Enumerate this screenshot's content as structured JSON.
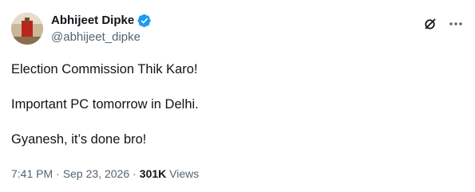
{
  "author": {
    "display_name": "Abhijeet Dipke",
    "handle": "@abhijeet_dipke",
    "verified": true,
    "verified_color": "#1d9bf0"
  },
  "header_actions": [
    {
      "icon": "grok-icon"
    },
    {
      "icon": "more-options-icon"
    }
  ],
  "tweet": {
    "lines": [
      "Election Commission Thik Karo!",
      "Important PC tomorrow in Delhi.",
      "Gyanesh, it’s done bro!"
    ]
  },
  "meta": {
    "time": "7:41 PM",
    "date": "Sep 23, 2026",
    "separator": "·",
    "views_count": "301K",
    "views_label": "Views"
  },
  "colors": {
    "text_primary": "#0f1419",
    "text_secondary": "#536471"
  }
}
